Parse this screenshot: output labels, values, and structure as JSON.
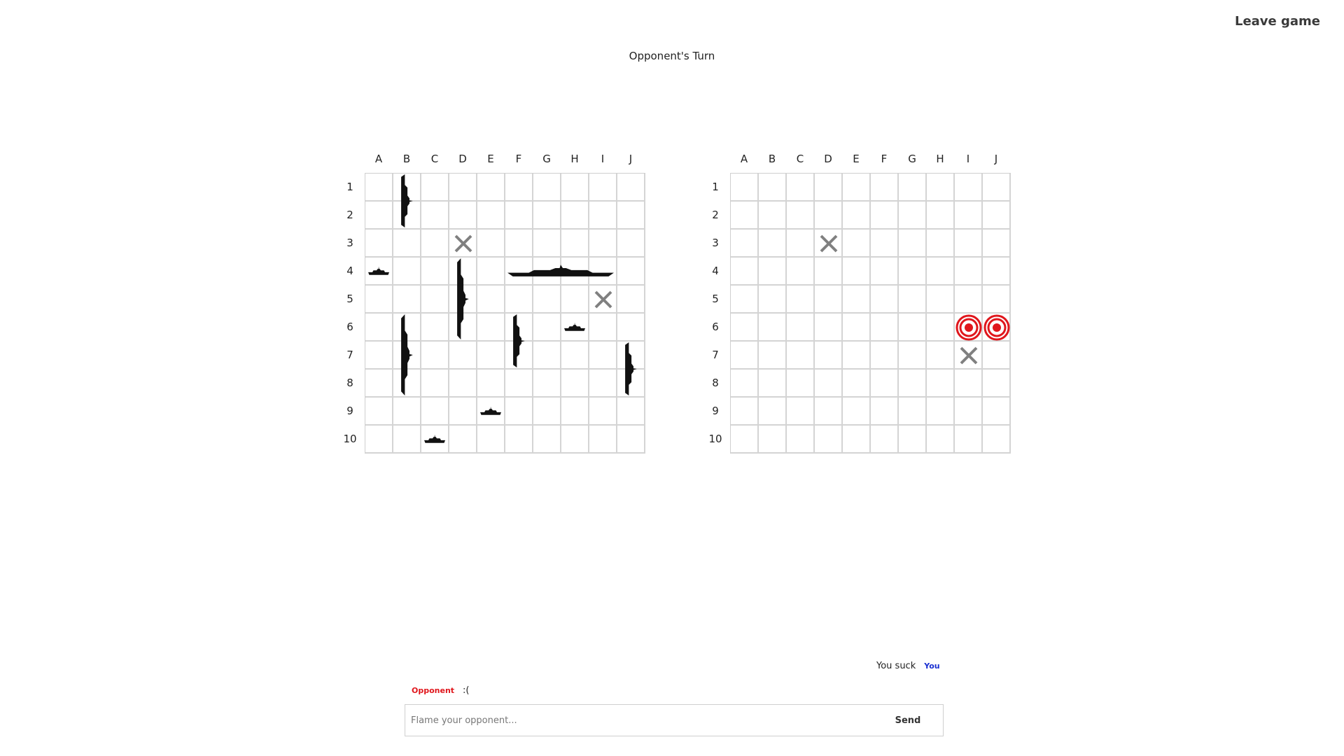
{
  "header": {
    "leave_label": "Leave game",
    "turn_status": "Opponent's Turn"
  },
  "columns": [
    "A",
    "B",
    "C",
    "D",
    "E",
    "F",
    "G",
    "H",
    "I",
    "J"
  ],
  "rows": [
    "1",
    "2",
    "3",
    "4",
    "5",
    "6",
    "7",
    "8",
    "9",
    "10"
  ],
  "colors": {
    "miss": "#808080",
    "hit": "#e0161c",
    "ship": "#111111",
    "grid_line": "#d4d4d4"
  },
  "player_board": {
    "ships": [
      {
        "col": "B",
        "row": 1,
        "length": 2,
        "orientation": "vertical"
      },
      {
        "col": "A",
        "row": 4,
        "length": 1,
        "orientation": "horizontal"
      },
      {
        "col": "F",
        "row": 4,
        "length": 4,
        "orientation": "horizontal"
      },
      {
        "col": "D",
        "row": 4,
        "length": 3,
        "orientation": "vertical"
      },
      {
        "col": "B",
        "row": 6,
        "length": 3,
        "orientation": "vertical"
      },
      {
        "col": "F",
        "row": 6,
        "length": 2,
        "orientation": "vertical"
      },
      {
        "col": "H",
        "row": 6,
        "length": 1,
        "orientation": "horizontal"
      },
      {
        "col": "J",
        "row": 7,
        "length": 2,
        "orientation": "vertical"
      },
      {
        "col": "E",
        "row": 9,
        "length": 1,
        "orientation": "horizontal"
      },
      {
        "col": "C",
        "row": 10,
        "length": 1,
        "orientation": "horizontal"
      }
    ],
    "shots": [
      {
        "col": "D",
        "row": 3,
        "result": "miss"
      },
      {
        "col": "I",
        "row": 5,
        "result": "miss"
      }
    ]
  },
  "opponent_board": {
    "shots": [
      {
        "col": "D",
        "row": 3,
        "result": "miss"
      },
      {
        "col": "I",
        "row": 6,
        "result": "hit"
      },
      {
        "col": "J",
        "row": 6,
        "result": "hit"
      },
      {
        "col": "I",
        "row": 7,
        "result": "miss"
      }
    ]
  },
  "chat": {
    "messages": [
      {
        "author": "You",
        "text": "You suck"
      },
      {
        "author": "Opponent",
        "text": ":("
      }
    ],
    "input_placeholder": "Flame your opponent...",
    "input_value": "",
    "send_label": "Send"
  }
}
